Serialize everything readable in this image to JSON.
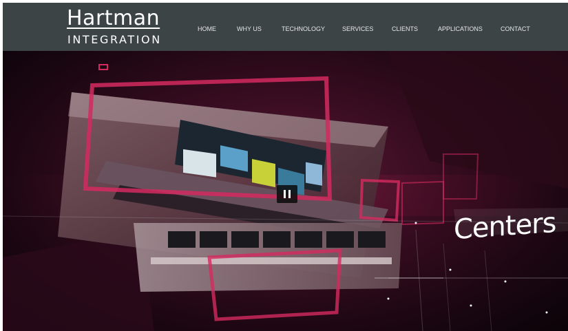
{
  "brand": {
    "name_top": "Hartman",
    "name_bottom": "INTEGRATION"
  },
  "nav": {
    "items": [
      {
        "label": "HOME"
      },
      {
        "label": "WHY US"
      },
      {
        "label": "TECHNOLOGY"
      },
      {
        "label": "SERVICES"
      },
      {
        "label": "CLIENTS"
      },
      {
        "label": "APPLICATIONS"
      },
      {
        "label": "CONTACT"
      }
    ]
  },
  "hero": {
    "caption": "Centers",
    "pause_icon": "pause-icon"
  },
  "colors": {
    "header_bg": "#3d4446",
    "hero_accent": "#d42a5f",
    "nav_text": "#e6e6e6"
  }
}
